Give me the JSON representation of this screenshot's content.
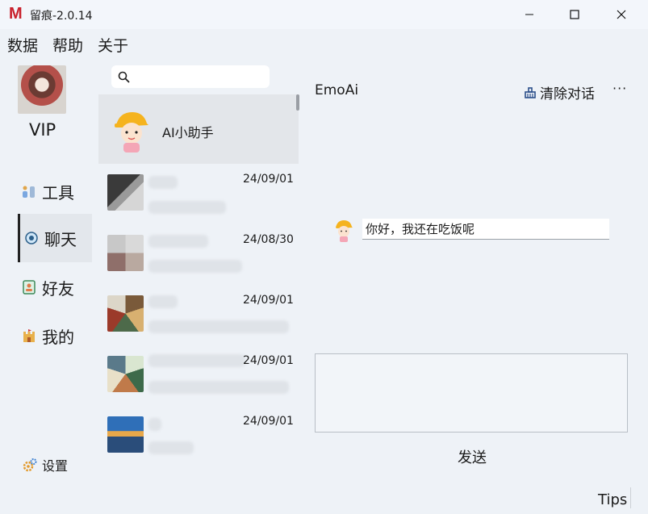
{
  "window": {
    "logo": "M",
    "title": "留痕-2.0.14",
    "controls": [
      "minimize",
      "maximize",
      "close"
    ]
  },
  "menu": [
    "数据",
    "帮助",
    "关于"
  ],
  "user": {
    "badge": "VIP"
  },
  "nav": [
    {
      "label": "工具",
      "icon": "tools-icon"
    },
    {
      "label": "聊天",
      "icon": "chat-icon",
      "active": true
    },
    {
      "label": "好友",
      "icon": "contacts-icon"
    },
    {
      "label": "我的",
      "icon": "castle-icon"
    }
  ],
  "settings": {
    "label": "设置",
    "icon": "gear-icon"
  },
  "search": {
    "placeholder": ""
  },
  "conversations": [
    {
      "name": "AI小助手",
      "date": "",
      "active": true
    },
    {
      "name": "",
      "date": "24/09/01"
    },
    {
      "name": "",
      "date": "24/08/30"
    },
    {
      "name": "",
      "date": "24/09/01"
    },
    {
      "name": "",
      "date": "24/09/01"
    },
    {
      "name": "",
      "date": "24/09/01"
    }
  ],
  "chat": {
    "title": "EmoAi",
    "clear_label": "清除对话",
    "more_label": "···",
    "messages": [
      {
        "text": "你好，我还在吃饭呢"
      }
    ],
    "input_value": "",
    "send_label": "发送"
  },
  "footer": {
    "tips": "Tips"
  },
  "colors": {
    "accent": "#c8202c",
    "background": "#eef2f7",
    "active_item": "#e3e6ea"
  }
}
